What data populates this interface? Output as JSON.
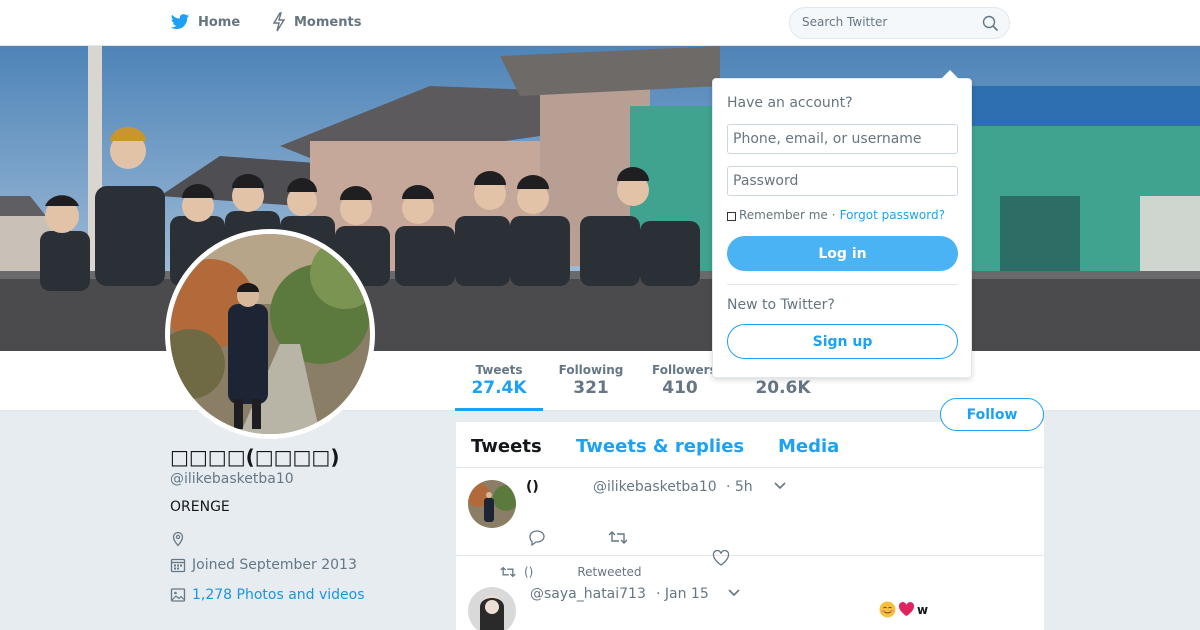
{
  "colors": {
    "accent": "#1da1f2",
    "background": "#e6ecf0",
    "muted": "#657786"
  },
  "nav": {
    "home": {
      "label": "Home",
      "icon": "bird-icon"
    },
    "moments": {
      "label": "Moments",
      "icon": "lightning-icon"
    },
    "search": {
      "placeholder": "Search Twitter",
      "icon": "search-icon"
    }
  },
  "stats": {
    "tweets": {
      "label": "Tweets",
      "value": "27.4K"
    },
    "following": {
      "label": "Following",
      "value": "321"
    },
    "followers": {
      "label": "Followers",
      "value": "410"
    },
    "likes": {
      "label": "",
      "value": "20.6K"
    }
  },
  "follow_label": "Follow",
  "profile": {
    "name": "□□□□(□□□□)",
    "handle": "@ilikebasketba10",
    "bio": "ORENGE",
    "joined": "Joined September 2013",
    "photos": "1,278 Photos and videos"
  },
  "timeline": {
    "tabs": [
      "Tweets",
      "Tweets & replies",
      "Media"
    ],
    "tweets": [
      {
        "name": "()",
        "handle": "@ilikebasketba10",
        "time": "· 5h"
      },
      {
        "retweeter": "()",
        "retweet_label": "Retweeted",
        "handle": "@saya_hatai713",
        "time": "· Jan 15",
        "text_suffix": "w"
      }
    ]
  },
  "login": {
    "title": "Have an account?",
    "username_placeholder": "Phone, email, or username",
    "password_placeholder": "Password",
    "remember": "Remember me",
    "separator": "·",
    "forgot": "Forgot password?",
    "login_label": "Log in",
    "new_title": "New to Twitter?",
    "signup_label": "Sign up"
  }
}
